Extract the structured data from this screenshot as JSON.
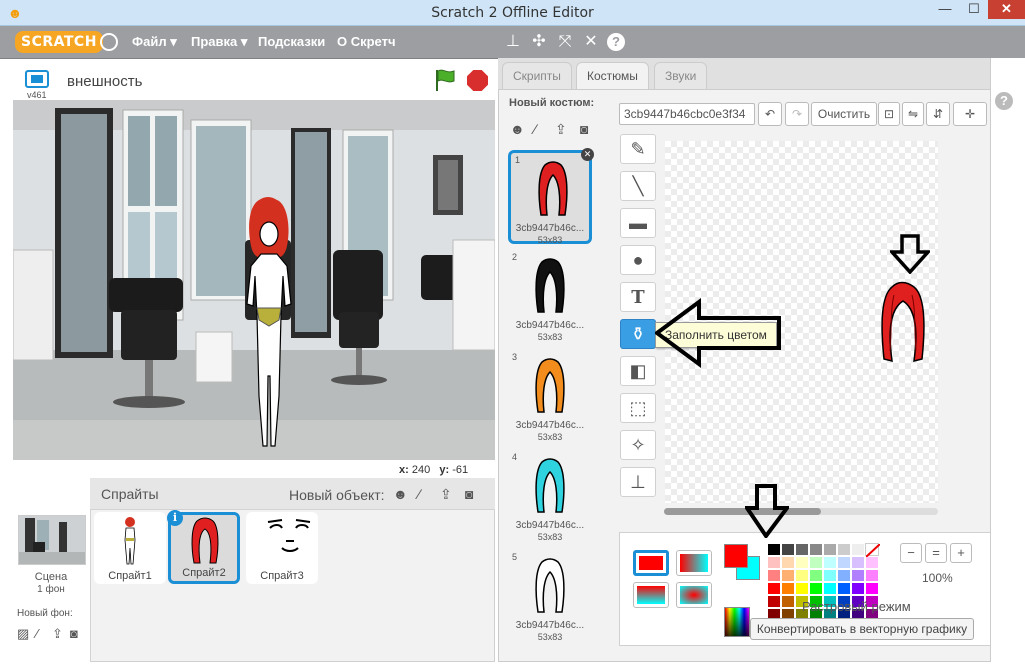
{
  "window": {
    "title": "Scratch 2 Offline Editor",
    "app_icon": "cat-icon",
    "minimize": "—",
    "maximize": "☐",
    "close": "✕"
  },
  "menu": {
    "logo": "SCRATCH",
    "file": "Файл ▾",
    "edit": "Правка ▾",
    "tips": "Подсказки",
    "about": "О Скретч"
  },
  "stage": {
    "project_name": "внешность",
    "version": "v461",
    "x_label": "x:",
    "x_value": "240",
    "y_label": "y:",
    "y_value": "-61"
  },
  "sprites": {
    "title": "Спрайты",
    "new_object": "Новый объект:",
    "scene_label": "Сцена",
    "scene_sub": "1 фон",
    "new_backdrop": "Новый фон:",
    "info_badge": "i",
    "items": [
      {
        "name": "Спрайт1"
      },
      {
        "name": "Спрайт2"
      },
      {
        "name": "Спрайт3"
      }
    ]
  },
  "tabs": {
    "scripts": "Скрипты",
    "costumes": "Костюмы",
    "sounds": "Звуки"
  },
  "costumes": {
    "new_costume": "Новый костюм:",
    "items": [
      {
        "num": "1",
        "name": "3cb9447b46c...",
        "size": "53x83",
        "color": "#e02020"
      },
      {
        "num": "2",
        "name": "3cb9447b46c...",
        "size": "53x83",
        "color": "#111111"
      },
      {
        "num": "3",
        "name": "3cb9447b46c...",
        "size": "53x83",
        "color": "#f28c1c"
      },
      {
        "num": "4",
        "name": "3cb9447b46c...",
        "size": "53x83",
        "color": "#2fd3e0"
      },
      {
        "num": "5",
        "name": "3cb9447b46c...",
        "size": "53x83",
        "color": "#ffffff"
      }
    ]
  },
  "editor": {
    "costume_name": "3cb9447b46cbc0e3f34",
    "clear": "Очистить",
    "tooltip": "Заполнить цветом",
    "zoom": "100%",
    "mode": "Растровый режим",
    "convert": "Конвертировать в векторную графику",
    "zoom_out": "−",
    "zoom_reset": "=",
    "zoom_in": "+"
  },
  "colors": {
    "accent": "#1a8fd6",
    "primary": "#ff0000",
    "secondary": "#00ffff",
    "palette": [
      "#000000",
      "#444444",
      "#666666",
      "#888888",
      "#aaaaaa",
      "#cccccc",
      "#eeeeee",
      "#ffffff",
      "#ffc0c0",
      "#ffd8b0",
      "#ffffc0",
      "#c0ffc0",
      "#c0ffff",
      "#c0d8ff",
      "#d8c0ff",
      "#ffc0ff",
      "#ff8080",
      "#ffb070",
      "#ffff80",
      "#80ff80",
      "#80ffff",
      "#80b0ff",
      "#b080ff",
      "#ff80ff",
      "#ff0000",
      "#ff8000",
      "#ffff00",
      "#00ff00",
      "#00ffff",
      "#0060ff",
      "#8000ff",
      "#ff00ff",
      "#c00000",
      "#c06000",
      "#c0c000",
      "#00c000",
      "#00c0c0",
      "#0040c0",
      "#6000c0",
      "#c000c0",
      "#800000",
      "#804000",
      "#808000",
      "#008000",
      "#008080",
      "#002080",
      "#400080",
      "#800080"
    ]
  }
}
